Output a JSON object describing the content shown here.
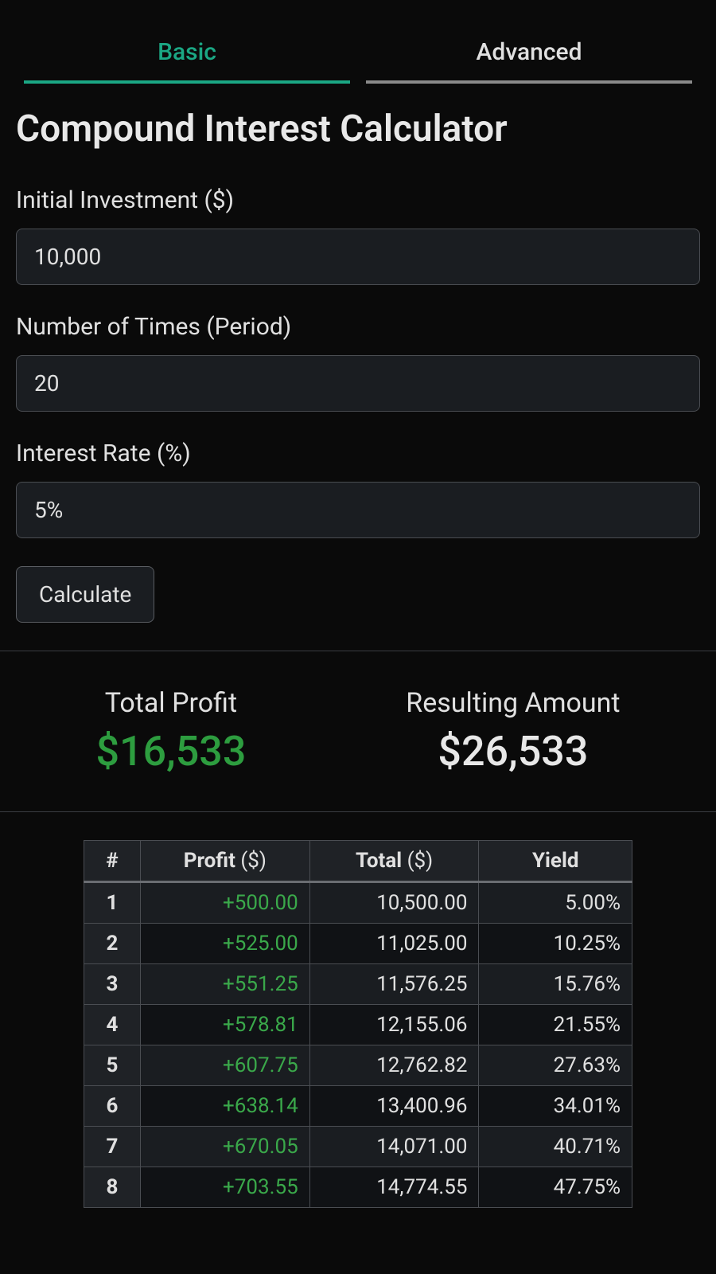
{
  "tabs": {
    "basic": "Basic",
    "advanced": "Advanced"
  },
  "header": {
    "title": "Compound Interest Calculator"
  },
  "form": {
    "initial_label": "Initial Investment ($)",
    "initial_value": "10,000",
    "periods_label": "Number of Times (Period)",
    "periods_value": "20",
    "rate_label": "Interest Rate (%)",
    "rate_value": "5%",
    "calculate_label": "Calculate"
  },
  "summary": {
    "profit_label": "Total Profit",
    "profit_value": "$16,533",
    "result_label": "Resulting Amount",
    "result_value": "$26,533"
  },
  "table": {
    "headers": {
      "idx": "#",
      "profit": "Profit",
      "profit_unit": " ($)",
      "total": "Total",
      "total_unit": " ($)",
      "yield": "Yield"
    },
    "rows": [
      {
        "idx": "1",
        "profit": "+500.00",
        "total": "10,500.00",
        "yield": "5.00%"
      },
      {
        "idx": "2",
        "profit": "+525.00",
        "total": "11,025.00",
        "yield": "10.25%"
      },
      {
        "idx": "3",
        "profit": "+551.25",
        "total": "11,576.25",
        "yield": "15.76%"
      },
      {
        "idx": "4",
        "profit": "+578.81",
        "total": "12,155.06",
        "yield": "21.55%"
      },
      {
        "idx": "5",
        "profit": "+607.75",
        "total": "12,762.82",
        "yield": "27.63%"
      },
      {
        "idx": "6",
        "profit": "+638.14",
        "total": "13,400.96",
        "yield": "34.01%"
      },
      {
        "idx": "7",
        "profit": "+670.05",
        "total": "14,071.00",
        "yield": "40.71%"
      },
      {
        "idx": "8",
        "profit": "+703.55",
        "total": "14,774.55",
        "yield": "47.75%"
      }
    ]
  }
}
